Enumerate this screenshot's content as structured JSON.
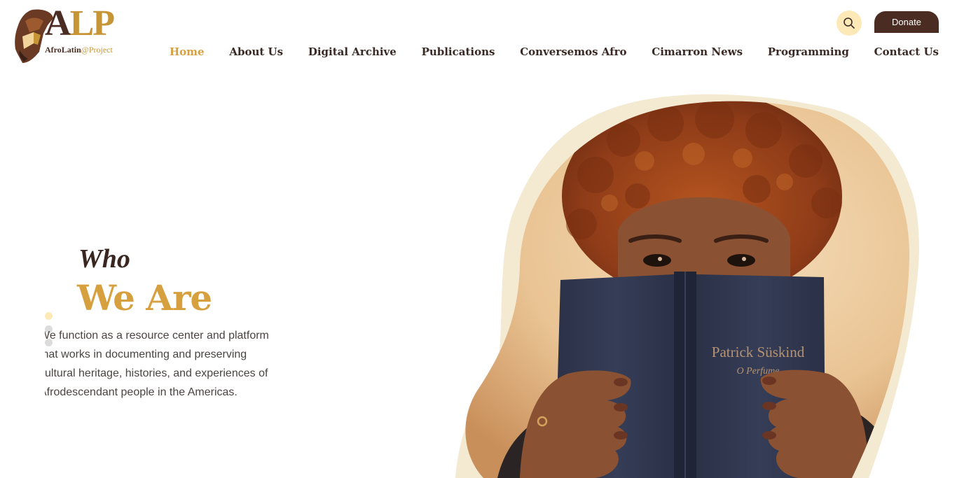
{
  "header": {
    "logo": {
      "letters": "ALP",
      "subtitle_main": "AfroLatin",
      "subtitle_accent": "@Project"
    },
    "search_icon": "search-icon",
    "donate_label": "Donate"
  },
  "nav": {
    "items": [
      {
        "label": "Home",
        "active": true
      },
      {
        "label": "About Us"
      },
      {
        "label": "Digital Archive"
      },
      {
        "label": "Publications"
      },
      {
        "label": "Conversemos Afro"
      },
      {
        "label": "Cimarron News"
      },
      {
        "label": "Programming"
      },
      {
        "label": "Contact Us"
      }
    ]
  },
  "hero": {
    "title_line1": "Who",
    "title_line2": "We Are",
    "description": "We function as a resource center and platform that works in documenting and preserving cultural heritage, histories, and experiences of Afrodescendant people in the Americas.",
    "book_author": "Patrick Süskind",
    "book_title": "O Perfume"
  },
  "colors": {
    "brand_brown": "#4a2c22",
    "brand_gold": "#d7a03f",
    "search_bg": "#fde9b8",
    "blob_cream": "#f4ead2"
  }
}
